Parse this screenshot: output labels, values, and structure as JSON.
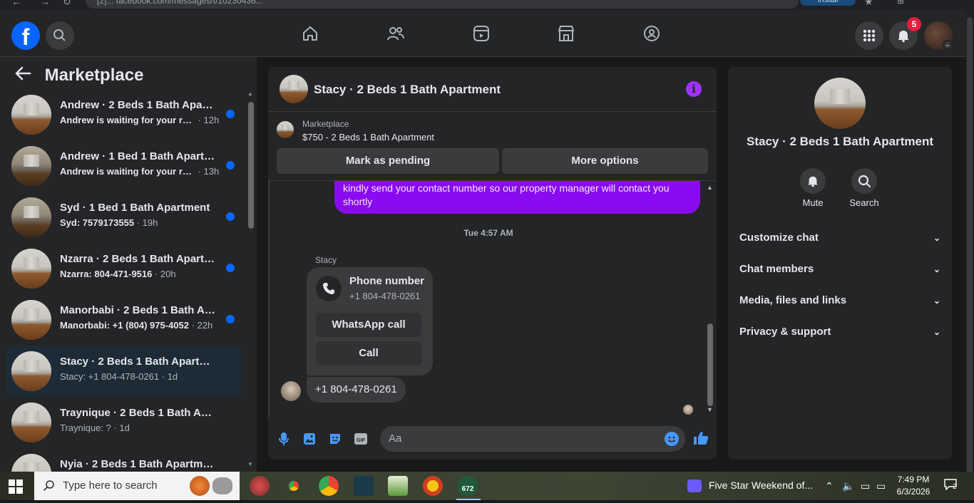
{
  "browser": {
    "url_fragment": "[2]... facebook.com/messages/t/10230436...",
    "install_label": "Install"
  },
  "left": {
    "title": "Marketplace",
    "conversations": [
      {
        "title": "Andrew · 2 Beds 1 Bath Apart...",
        "message": "Andrew is waiting for your res...",
        "time": " · 12h",
        "unread": true
      },
      {
        "title": "Andrew · 1 Bed 1 Bath Apartm...",
        "message": "Andrew is waiting for your res...",
        "time": " · 13h",
        "unread": true
      },
      {
        "title": "Syd · 1 Bed 1 Bath Apartment",
        "message": "Syd: 7579173555",
        "time": " · 19h",
        "unread": true
      },
      {
        "title": "Nzarra · 2 Beds 1 Bath Apartm...",
        "message": "Nzarra: 804-471-9516",
        "time": " · 20h",
        "unread": true
      },
      {
        "title": "Manorbabi · 2 Beds 1 Bath Apa...",
        "message": "Manorbabi: +1 (804) 975-4052",
        "time": " · 22h",
        "unread": true
      },
      {
        "title": "Stacy · 2 Beds 1 Bath Apartment",
        "message": "Stacy: +1 804-478-0261",
        "time": " · 1d",
        "unread": false
      },
      {
        "title": "Traynique · 2 Beds 1 Bath Apart...",
        "message": "Traynique: ?",
        "time": " · 1d",
        "unread": false
      },
      {
        "title": "Nyia · 2 Beds 1 Bath Apartment",
        "message": "",
        "time": "",
        "unread": false
      }
    ]
  },
  "top": {
    "notification_count": "5"
  },
  "chat": {
    "title": "Stacy · 2 Beds 1 Bath Apartment",
    "listing_label": "Marketplace",
    "listing_title": "$750 - 2 Beds 1 Bath Apartment",
    "mark_pending": "Mark as pending",
    "more_options": "More options",
    "outgoing_message": "kindly send your contact number so our property manager will contact you shortly",
    "timestamp": "Tue 4:57 AM",
    "sender": "Stacy",
    "card_label": "Phone number",
    "card_value": "+1 804-478-0261",
    "card_whatsapp": "WhatsApp call",
    "card_call": "Call",
    "incoming_message": "+1 804-478-0261",
    "input_placeholder": "Aa"
  },
  "info": {
    "name": "Stacy · 2 Beds 1 Bath Apartment",
    "mute": "Mute",
    "search": "Search",
    "rows": [
      "Customize chat",
      "Chat members",
      "Media, files and links",
      "Privacy & support"
    ]
  },
  "taskbar": {
    "search_placeholder": "Type here to search",
    "media_title": "Five Star Weekend of...",
    "time": "7:49 PM",
    "date": "6/3/2026",
    "notification_count": "2",
    "app_badge": "672"
  },
  "colors": {
    "accent": "#0866ff",
    "outgoing_bubble": "#8a0bf0",
    "info_icon": "#a033ff",
    "background": "#18191a"
  }
}
